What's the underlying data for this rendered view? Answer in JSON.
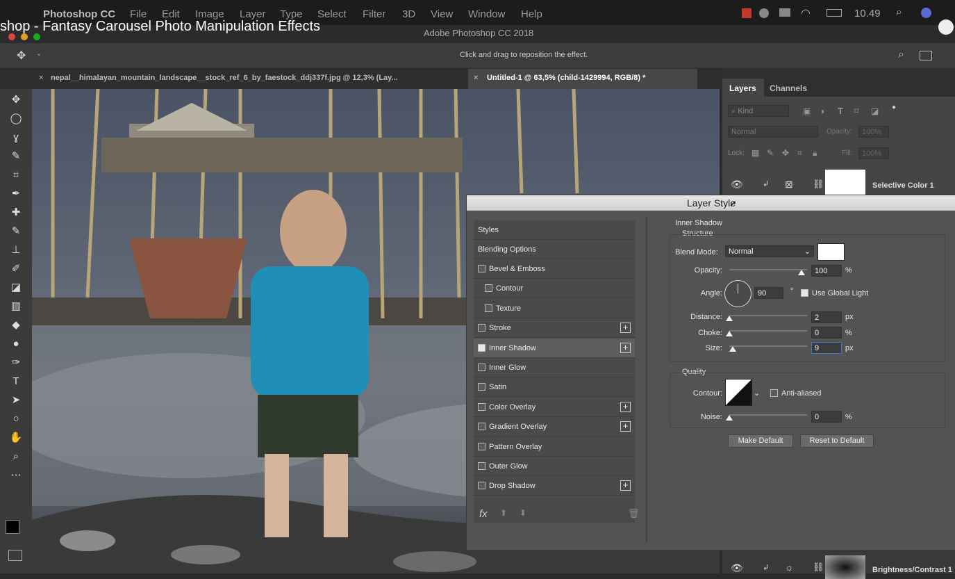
{
  "mac_menu": {
    "app": "Photoshop CC",
    "items": [
      "File",
      "Edit",
      "Image",
      "Layer",
      "Type",
      "Select",
      "Filter",
      "3D",
      "View",
      "Window",
      "Help"
    ],
    "clock": "10.49"
  },
  "video_title": "shop - Fantasy Carousel Photo Manipulation Effects",
  "app_title": "Adobe Photoshop CC 2018",
  "options_hint": "Click and drag to reposition the effect.",
  "tabs": [
    {
      "label": "nepal__himalayan_mountain_landscape__stock_ref_6_by_faestock_ddj337f.jpg @ 12,3% (Lay...",
      "active": false
    },
    {
      "label": "Untitled-1 @ 63,5% (child-1429994, RGB/8) *",
      "active": true
    }
  ],
  "layers_panel": {
    "tabs": [
      "Layers",
      "Channels"
    ],
    "filter_placeholder": "Kind",
    "blend": "Normal",
    "opacity_label": "Opacity:",
    "opacity_value": "100%",
    "lock_label": "Lock:",
    "fill_label": "Fill:",
    "fill_value": "100%",
    "layers": [
      {
        "name": "Selective Color 1"
      },
      {
        "name": "Brightness/Contrast 1"
      }
    ]
  },
  "dialog": {
    "title": "Layer Style",
    "styles_header": "Styles",
    "blending_options": "Blending Options",
    "items": [
      {
        "label": "Bevel & Emboss",
        "checked": false,
        "plus": false,
        "indent": false
      },
      {
        "label": "Contour",
        "checked": false,
        "plus": false,
        "indent": true
      },
      {
        "label": "Texture",
        "checked": false,
        "plus": false,
        "indent": true
      },
      {
        "label": "Stroke",
        "checked": false,
        "plus": true,
        "indent": false
      },
      {
        "label": "Inner Shadow",
        "checked": true,
        "plus": true,
        "indent": false
      },
      {
        "label": "Inner Glow",
        "checked": false,
        "plus": false,
        "indent": false
      },
      {
        "label": "Satin",
        "checked": false,
        "plus": false,
        "indent": false
      },
      {
        "label": "Color Overlay",
        "checked": false,
        "plus": true,
        "indent": false
      },
      {
        "label": "Gradient Overlay",
        "checked": false,
        "plus": true,
        "indent": false
      },
      {
        "label": "Pattern Overlay",
        "checked": false,
        "plus": false,
        "indent": false
      },
      {
        "label": "Outer Glow",
        "checked": false,
        "plus": false,
        "indent": false
      },
      {
        "label": "Drop Shadow",
        "checked": false,
        "plus": true,
        "indent": false
      }
    ],
    "fx_label": "fx",
    "section_title": "Inner Shadow",
    "structure_title": "Structure",
    "blend_mode_label": "Blend Mode:",
    "blend_mode_value": "Normal",
    "opacity_label": "Opacity:",
    "opacity_value": "100",
    "angle_label": "Angle:",
    "angle_value": "90",
    "degree_symbol": "°",
    "use_global_light": "Use Global Light",
    "distance_label": "Distance:",
    "distance_value": "2",
    "choke_label": "Choke:",
    "choke_value": "0",
    "size_label": "Size:",
    "size_value": "9",
    "unit_px": "px",
    "unit_pct": "%",
    "quality_title": "Quality",
    "contour_label": "Contour:",
    "anti_aliased": "Anti-aliased",
    "noise_label": "Noise:",
    "noise_value": "0",
    "make_default": "Make Default",
    "reset_default": "Reset to Default",
    "shadow_color": "#ffffff"
  }
}
